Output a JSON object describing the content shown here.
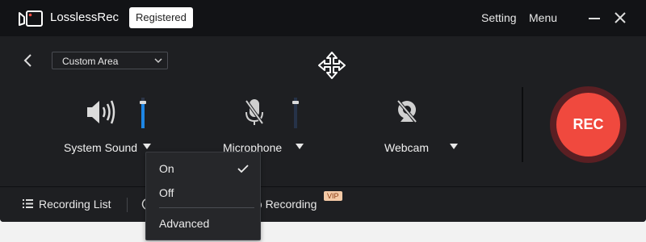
{
  "app": {
    "title": "LosslessRec",
    "badge": "Registered",
    "setting_label": "Setting",
    "menu_label": "Menu"
  },
  "capture": {
    "area_value": "Custom Area"
  },
  "sources": {
    "system_sound": {
      "label": "System Sound",
      "level": 0.85
    },
    "microphone": {
      "label": "Microphone",
      "level": 0.85,
      "muted": true
    },
    "webcam": {
      "label": "Webcam",
      "disabled": true
    }
  },
  "rec_button": {
    "label": "REC"
  },
  "bottom_bar": {
    "recording_list_label": "Recording List",
    "auto_recording_label": "to Recording",
    "vip_label": "VIP"
  },
  "dropdown": {
    "items": [
      {
        "label": "On",
        "checked": true
      },
      {
        "label": "Off",
        "checked": false
      },
      {
        "label": "Advanced",
        "checked": false
      }
    ]
  },
  "colors": {
    "accent_blue": "#1e86e5",
    "rec_red": "#f0493e",
    "vip": "#f3c9a6"
  }
}
